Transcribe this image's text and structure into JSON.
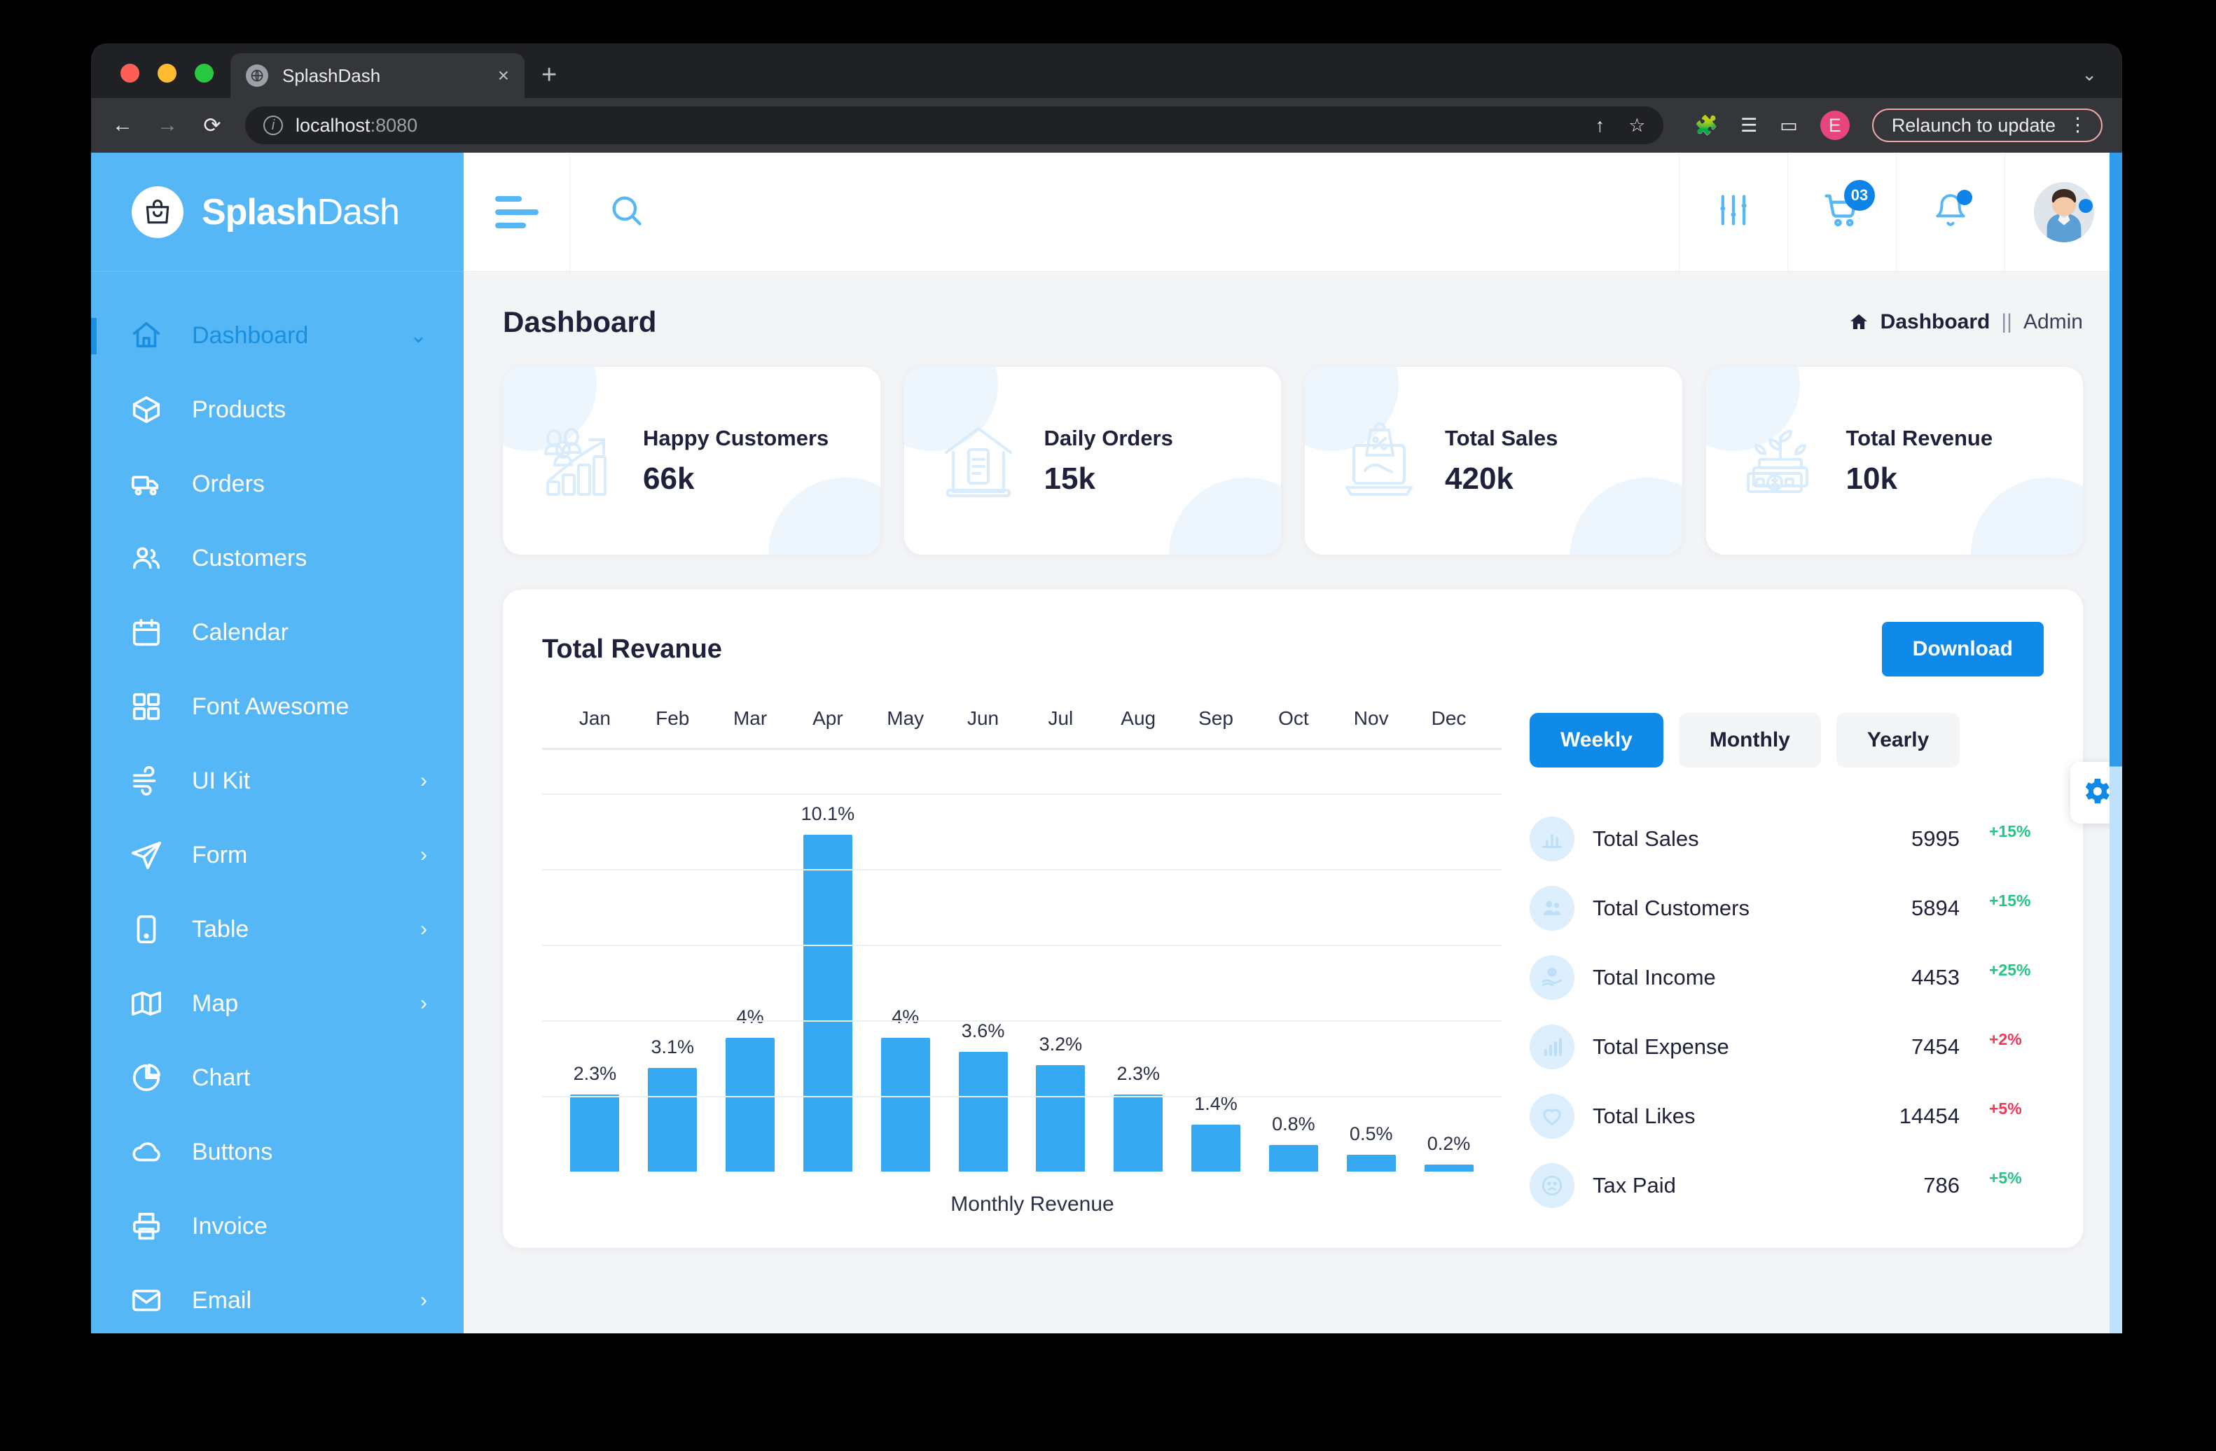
{
  "browser": {
    "tab_title": "SplashDash",
    "tab_close": "×",
    "new_tab": "+",
    "tabstrip_chevron": "⌄",
    "back": "←",
    "forward": "→",
    "reload": "⟳",
    "url_host": "localhost",
    "url_port": ":8080",
    "share_icon": "↑",
    "bookmark_icon": "☆",
    "extensions_icon": "🧩",
    "reading_list_icon": "☰",
    "sidepanel_icon": "▭",
    "profile_initial": "E",
    "relaunch_label": "Relaunch to update",
    "kebab": "⋮"
  },
  "sidebar": {
    "logo_bold": "Splash",
    "logo_light": "Dash",
    "items": [
      {
        "label": "Dashboard",
        "icon": "home-icon",
        "chevron": "⌄",
        "active": true
      },
      {
        "label": "Products",
        "icon": "box-icon",
        "chevron": "",
        "active": false
      },
      {
        "label": "Orders",
        "icon": "truck-icon",
        "chevron": "",
        "active": false
      },
      {
        "label": "Customers",
        "icon": "users-icon",
        "chevron": "",
        "active": false
      },
      {
        "label": "Calendar",
        "icon": "calendar-icon",
        "chevron": "",
        "active": false
      },
      {
        "label": "Font Awesome",
        "icon": "grid-icon",
        "chevron": "",
        "active": false
      },
      {
        "label": "UI Kit",
        "icon": "wind-icon",
        "chevron": "›",
        "active": false
      },
      {
        "label": "Form",
        "icon": "send-icon",
        "chevron": "›",
        "active": false
      },
      {
        "label": "Table",
        "icon": "tablet-icon",
        "chevron": "›",
        "active": false
      },
      {
        "label": "Map",
        "icon": "map-icon",
        "chevron": "›",
        "active": false
      },
      {
        "label": "Chart",
        "icon": "pie-chart-icon",
        "chevron": "",
        "active": false
      },
      {
        "label": "Buttons",
        "icon": "cloud-icon",
        "chevron": "",
        "active": false
      },
      {
        "label": "Invoice",
        "icon": "printer-icon",
        "chevron": "",
        "active": false
      },
      {
        "label": "Email",
        "icon": "mail-icon",
        "chevron": "›",
        "active": false
      }
    ]
  },
  "topbar": {
    "cart_badge": "03"
  },
  "page": {
    "title": "Dashboard",
    "breadcrumb_current": "Dashboard",
    "breadcrumb_separator": "||",
    "breadcrumb_sub": "Admin"
  },
  "kpis": [
    {
      "label": "Happy Customers",
      "value": "66k",
      "icon": "growth-people-icon"
    },
    {
      "label": "Daily Orders",
      "value": "15k",
      "icon": "store-icon"
    },
    {
      "label": "Total Sales",
      "value": "420k",
      "icon": "shopping-laptop-icon"
    },
    {
      "label": "Total Revenue",
      "value": "10k",
      "icon": "money-plant-icon"
    }
  ],
  "revenue_panel": {
    "title": "Total Revanue",
    "download_label": "Download",
    "segments": [
      {
        "label": "Weekly",
        "active": true
      },
      {
        "label": "Monthly",
        "active": false
      },
      {
        "label": "Yearly",
        "active": false
      }
    ],
    "stats": [
      {
        "name": "Total Sales",
        "value": "5995",
        "delta": "+15%",
        "direction": "up",
        "icon": "bar-chart-icon"
      },
      {
        "name": "Total Customers",
        "value": "5894",
        "delta": "+15%",
        "direction": "up",
        "icon": "users-icon"
      },
      {
        "name": "Total Income",
        "value": "4453",
        "delta": "+25%",
        "direction": "up",
        "icon": "hand-money-icon"
      },
      {
        "name": "Total Expense",
        "value": "7454",
        "delta": "+2%",
        "direction": "down",
        "icon": "bars-icon"
      },
      {
        "name": "Total Likes",
        "value": "14454",
        "delta": "+5%",
        "direction": "down",
        "icon": "heart-icon"
      },
      {
        "name": "Tax Paid",
        "value": "786",
        "delta": "+5%",
        "direction": "up",
        "icon": "sad-face-icon"
      }
    ]
  },
  "chart_data": {
    "type": "bar",
    "title": "Total Revanue",
    "xlabel": "Monthly Revenue",
    "ylabel": "",
    "categories": [
      "Jan",
      "Feb",
      "Mar",
      "Apr",
      "May",
      "Jun",
      "Jul",
      "Aug",
      "Sep",
      "Oct",
      "Nov",
      "Dec"
    ],
    "values": [
      2.3,
      3.1,
      4,
      10.1,
      4,
      3.6,
      3.2,
      2.3,
      1.4,
      0.8,
      0.5,
      0.2
    ],
    "labels": [
      "2.3%",
      "3.1%",
      "4%",
      "10.1%",
      "4%",
      "3.6%",
      "3.2%",
      "2.3%",
      "1.4%",
      "0.8%",
      "0.5%",
      "0.2%"
    ],
    "ylim": [
      0,
      11
    ],
    "grid": true,
    "legend": "none",
    "bar_color": "#36a9f2"
  },
  "colors": {
    "sidebar": "#55b7f5",
    "accent": "#0f8ae8",
    "bar": "#36a9f2",
    "up": "#22c585",
    "down": "#f3365a",
    "text": "#1e2139"
  }
}
